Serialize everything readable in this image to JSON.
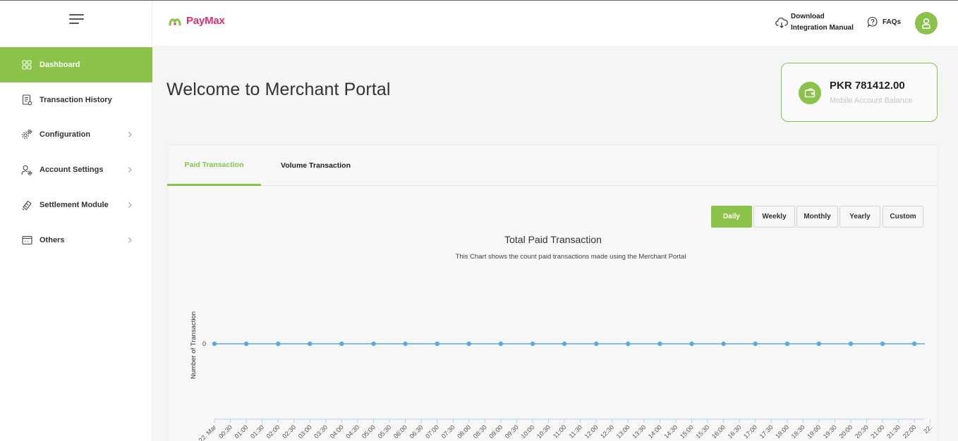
{
  "brand": {
    "name": "PayMax",
    "color": "#e0306e",
    "accent": "#8bc34a"
  },
  "sidebar": {
    "items": [
      {
        "label": "Dashboard",
        "icon": "dashboard-grid-icon",
        "active": true,
        "chevron": false
      },
      {
        "label": "Transaction History",
        "icon": "document-icon",
        "active": false,
        "chevron": false
      },
      {
        "label": "Configuration",
        "icon": "gears-icon",
        "active": false,
        "chevron": true
      },
      {
        "label": "Account Settings",
        "icon": "user-gear-icon",
        "active": false,
        "chevron": true
      },
      {
        "label": "Settlement Module",
        "icon": "settlement-icon",
        "active": false,
        "chevron": true
      },
      {
        "label": "Others",
        "icon": "window-icon",
        "active": false,
        "chevron": true
      }
    ]
  },
  "header": {
    "download_line1": "Download",
    "download_line2": "Integration Manual",
    "faq_label": "FAQs"
  },
  "main": {
    "welcome": "Welcome to Merchant Portal",
    "balance_amount": "PKR 781412.00",
    "balance_label": "Mobile Account Balance"
  },
  "tabs": [
    "Paid Transaction",
    "Volume Transaction"
  ],
  "range_buttons": [
    {
      "label": "Daily",
      "active": true
    },
    {
      "label": "Weekly",
      "active": false
    },
    {
      "label": "Monthly",
      "active": false
    },
    {
      "label": "Yearly",
      "active": false
    },
    {
      "label": "Custom",
      "active": false
    }
  ],
  "chart_data": {
    "type": "line",
    "title": "Total Paid Transaction",
    "subtitle": "This Chart shows the count paid transactions made using the Merchant Portal",
    "ylabel": "Number of Transaction",
    "xlabel": "",
    "ytick_labels": [
      "0"
    ],
    "color": "#5aa9e6",
    "x": [
      "22. Mar",
      "00:30",
      "01:00",
      "01:30",
      "02:00",
      "02:30",
      "03:00",
      "03:30",
      "04:00",
      "04:30",
      "05:00",
      "05:30",
      "06:00",
      "06:30",
      "07:00",
      "07:30",
      "08:00",
      "08:30",
      "09:00",
      "09:30",
      "10:00",
      "10:30",
      "11:00",
      "11:30",
      "12:00",
      "12:30",
      "13:00",
      "13:30",
      "14:00",
      "14:30",
      "15:00",
      "15:30",
      "16:00",
      "16:30",
      "17:00",
      "17:30",
      "18:00",
      "18:30",
      "19:00",
      "19:30",
      "20:00",
      "20:30",
      "21:00",
      "21:30",
      "22:00",
      "22:"
    ],
    "series": [
      {
        "values": [
          0,
          0,
          0,
          0,
          0,
          0,
          0,
          0,
          0,
          0,
          0,
          0,
          0,
          0,
          0,
          0,
          0,
          0,
          0,
          0,
          0,
          0,
          0,
          0,
          0,
          0,
          0,
          0,
          0,
          0,
          0,
          0,
          0,
          0,
          0,
          0,
          0,
          0,
          0,
          0,
          0,
          0,
          0,
          0,
          0
        ]
      }
    ]
  }
}
